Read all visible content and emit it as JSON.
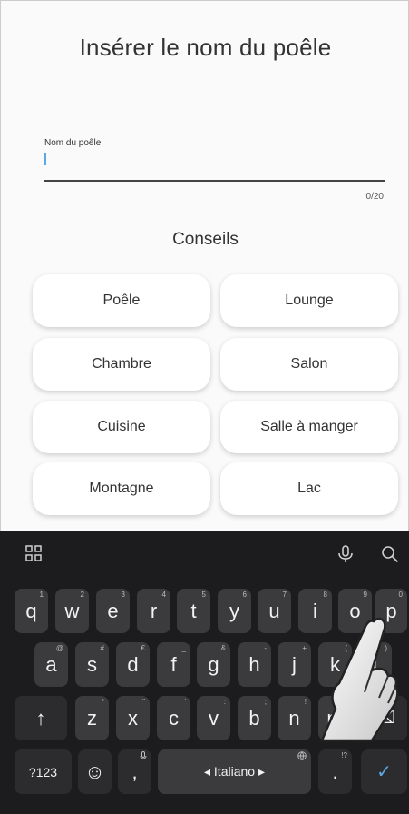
{
  "screen": {
    "title": "Insérer le nom du poêle",
    "field_label": "Nom du poêle",
    "counter": "0/20",
    "tips_title": "Conseils",
    "suggestions": [
      "Poêle",
      "Lounge",
      "Chambre",
      "Salon",
      "Cuisine",
      "Salle à manger",
      "Montagne",
      "Lac"
    ]
  },
  "keyboard": {
    "row1": [
      "q",
      "w",
      "e",
      "r",
      "t",
      "y",
      "u",
      "i",
      "o",
      "p"
    ],
    "row1_hints": [
      "1",
      "2",
      "3",
      "4",
      "5",
      "6",
      "7",
      "8",
      "9",
      "0"
    ],
    "row2": [
      "a",
      "s",
      "d",
      "f",
      "g",
      "h",
      "j",
      "k",
      "l"
    ],
    "row2_hints": [
      "@",
      "#",
      "€",
      "_",
      "&",
      "-",
      "+",
      "(",
      ")"
    ],
    "row3": [
      "z",
      "x",
      "c",
      "v",
      "b",
      "n",
      "m"
    ],
    "row3_hints": [
      "*",
      "\"",
      "'",
      ":",
      ";",
      "!",
      "?"
    ],
    "shift_label": "↑",
    "backspace_label": "⌫",
    "symbols_label": "?123",
    "emoji_label": "☺",
    "comma_label": ",",
    "space_label": "◂ Italiano ▸",
    "period_label": ".",
    "period_hint": "!?",
    "enter_label": "✓",
    "icons": [
      "grid-icon",
      "mic-icon",
      "search-icon",
      "globe-icon"
    ]
  },
  "colors": {
    "accent": "#5aa9e6",
    "keyboard_bg": "#1c1c1e",
    "key_bg": "#3b3b3d"
  }
}
